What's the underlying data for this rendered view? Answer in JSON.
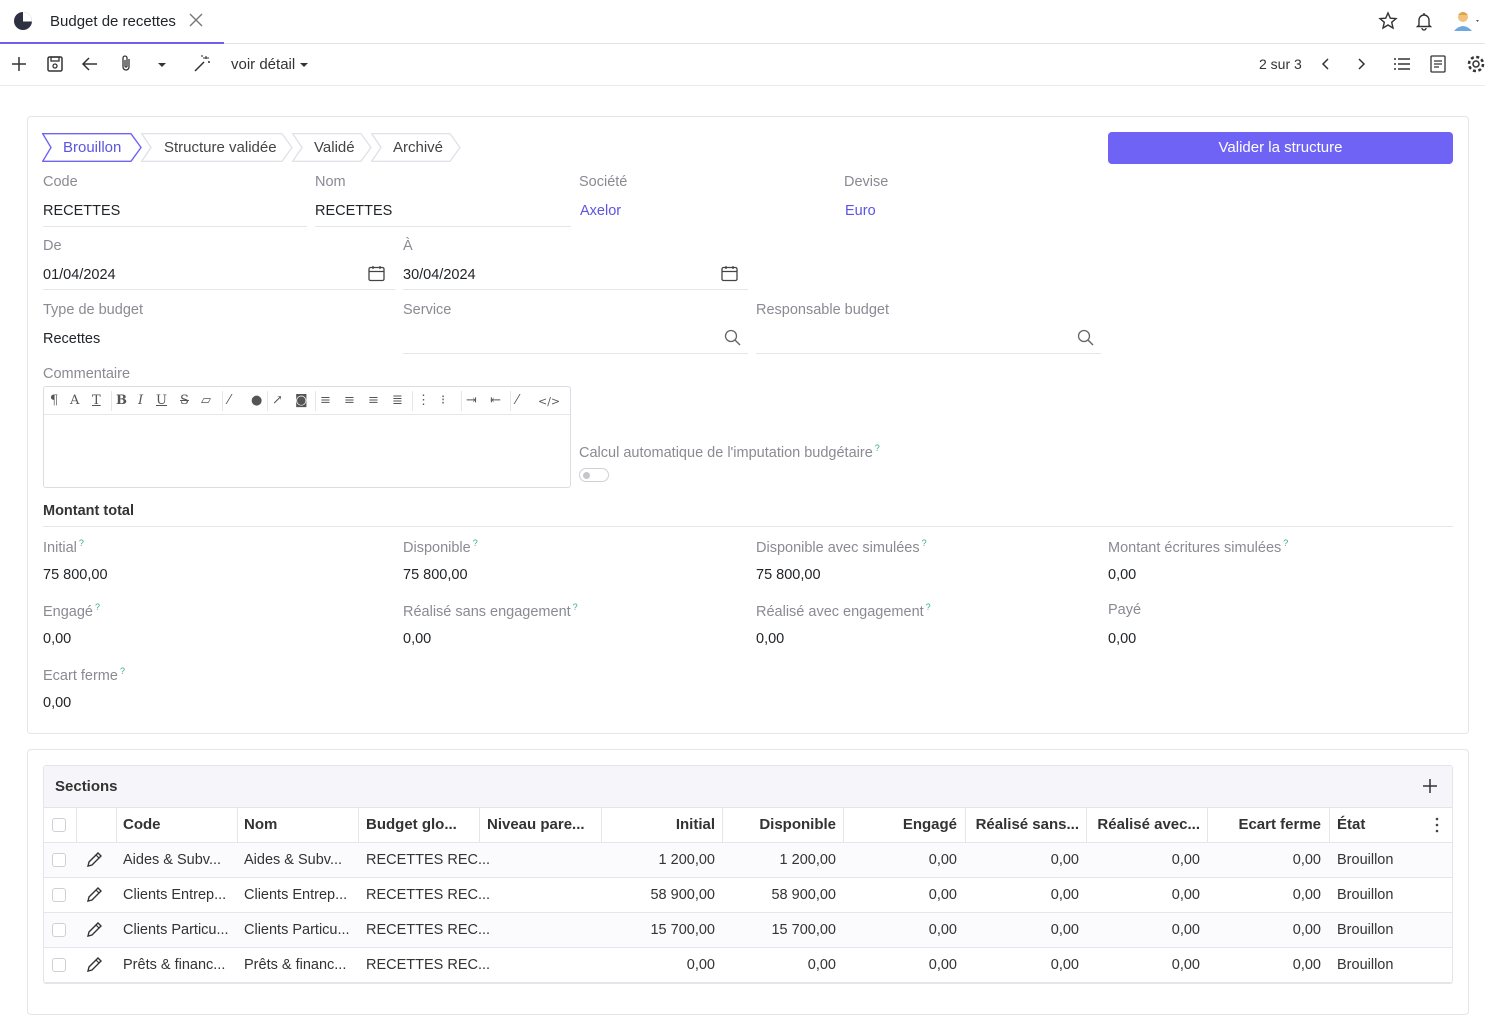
{
  "tab": {
    "title": "Budget de recettes"
  },
  "toolbar": {
    "voir_detail": "voir détail",
    "pager": "2 sur 3"
  },
  "stepper": {
    "steps": [
      "Brouillon",
      "Structure validée",
      "Validé",
      "Archivé"
    ],
    "active": "Brouillon"
  },
  "actions": {
    "validate": "Valider la structure"
  },
  "form": {
    "code": {
      "label": "Code",
      "value": "RECETTES"
    },
    "nom": {
      "label": "Nom",
      "value": "RECETTES"
    },
    "societe": {
      "label": "Société",
      "value": "Axelor"
    },
    "devise": {
      "label": "Devise",
      "value": "Euro"
    },
    "de": {
      "label": "De",
      "value": "01/04/2024"
    },
    "a": {
      "label": "À",
      "value": "30/04/2024"
    },
    "type": {
      "label": "Type de budget",
      "value": "Recettes"
    },
    "service": {
      "label": "Service",
      "value": ""
    },
    "responsable": {
      "label": "Responsable budget",
      "value": ""
    },
    "commentaire": {
      "label": "Commentaire"
    },
    "calcul": {
      "label": "Calcul automatique de l'imputation budgétaire"
    }
  },
  "totals": {
    "title": "Montant total",
    "initial": {
      "label": "Initial",
      "value": "75 800,00"
    },
    "disponible": {
      "label": "Disponible",
      "value": "75 800,00"
    },
    "disponible_sim": {
      "label": "Disponible avec simulées",
      "value": "75 800,00"
    },
    "montant_sim": {
      "label": "Montant écritures simulées",
      "value": "0,00"
    },
    "engage": {
      "label": "Engagé",
      "value": "0,00"
    },
    "realise_sans": {
      "label": "Réalisé sans engagement",
      "value": "0,00"
    },
    "realise_avec": {
      "label": "Réalisé avec engagement",
      "value": "0,00"
    },
    "paye": {
      "label": "Payé",
      "value": "0,00"
    },
    "ecart": {
      "label": "Ecart ferme",
      "value": "0,00"
    }
  },
  "sections": {
    "title": "Sections",
    "columns": [
      "Code",
      "Nom",
      "Budget glo...",
      "Niveau pare...",
      "Initial",
      "Disponible",
      "Engagé",
      "Réalisé sans...",
      "Réalisé avec...",
      "Ecart ferme",
      "État"
    ],
    "rows": [
      {
        "code": "Aides & Subv...",
        "nom": "Aides & Subv...",
        "budget": "RECETTES REC...",
        "niveau": "",
        "initial": "1 200,00",
        "disponible": "1 200,00",
        "engage": "0,00",
        "realise_sans": "0,00",
        "realise_avec": "0,00",
        "ecart": "0,00",
        "etat": "Brouillon"
      },
      {
        "code": "Clients Entrep...",
        "nom": "Clients Entrep...",
        "budget": "RECETTES REC...",
        "niveau": "",
        "initial": "58 900,00",
        "disponible": "58 900,00",
        "engage": "0,00",
        "realise_sans": "0,00",
        "realise_avec": "0,00",
        "ecart": "0,00",
        "etat": "Brouillon"
      },
      {
        "code": "Clients Particu...",
        "nom": "Clients Particu...",
        "budget": "RECETTES REC...",
        "niveau": "",
        "initial": "15 700,00",
        "disponible": "15 700,00",
        "engage": "0,00",
        "realise_sans": "0,00",
        "realise_avec": "0,00",
        "ecart": "0,00",
        "etat": "Brouillon"
      },
      {
        "code": "Prêts & financ...",
        "nom": "Prêts & financ...",
        "budget": "RECETTES REC...",
        "niveau": "",
        "initial": "0,00",
        "disponible": "0,00",
        "engage": "0,00",
        "realise_sans": "0,00",
        "realise_avec": "0,00",
        "ecart": "0,00",
        "etat": "Brouillon"
      }
    ]
  },
  "colors": {
    "accent": "#6f63f5",
    "link": "#5b55e0",
    "help": "#36b37e"
  }
}
